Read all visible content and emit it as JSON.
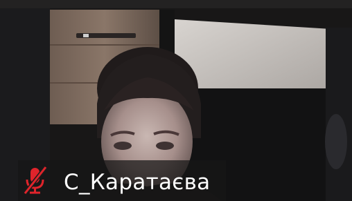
{
  "participant": {
    "name": "С_Каратаєва",
    "mic_icon": "microphone-muted-icon",
    "mic_muted": true
  },
  "colors": {
    "muted_icon": "#e0242b",
    "name_text": "#ffffff",
    "name_tag_background": "#161616"
  }
}
